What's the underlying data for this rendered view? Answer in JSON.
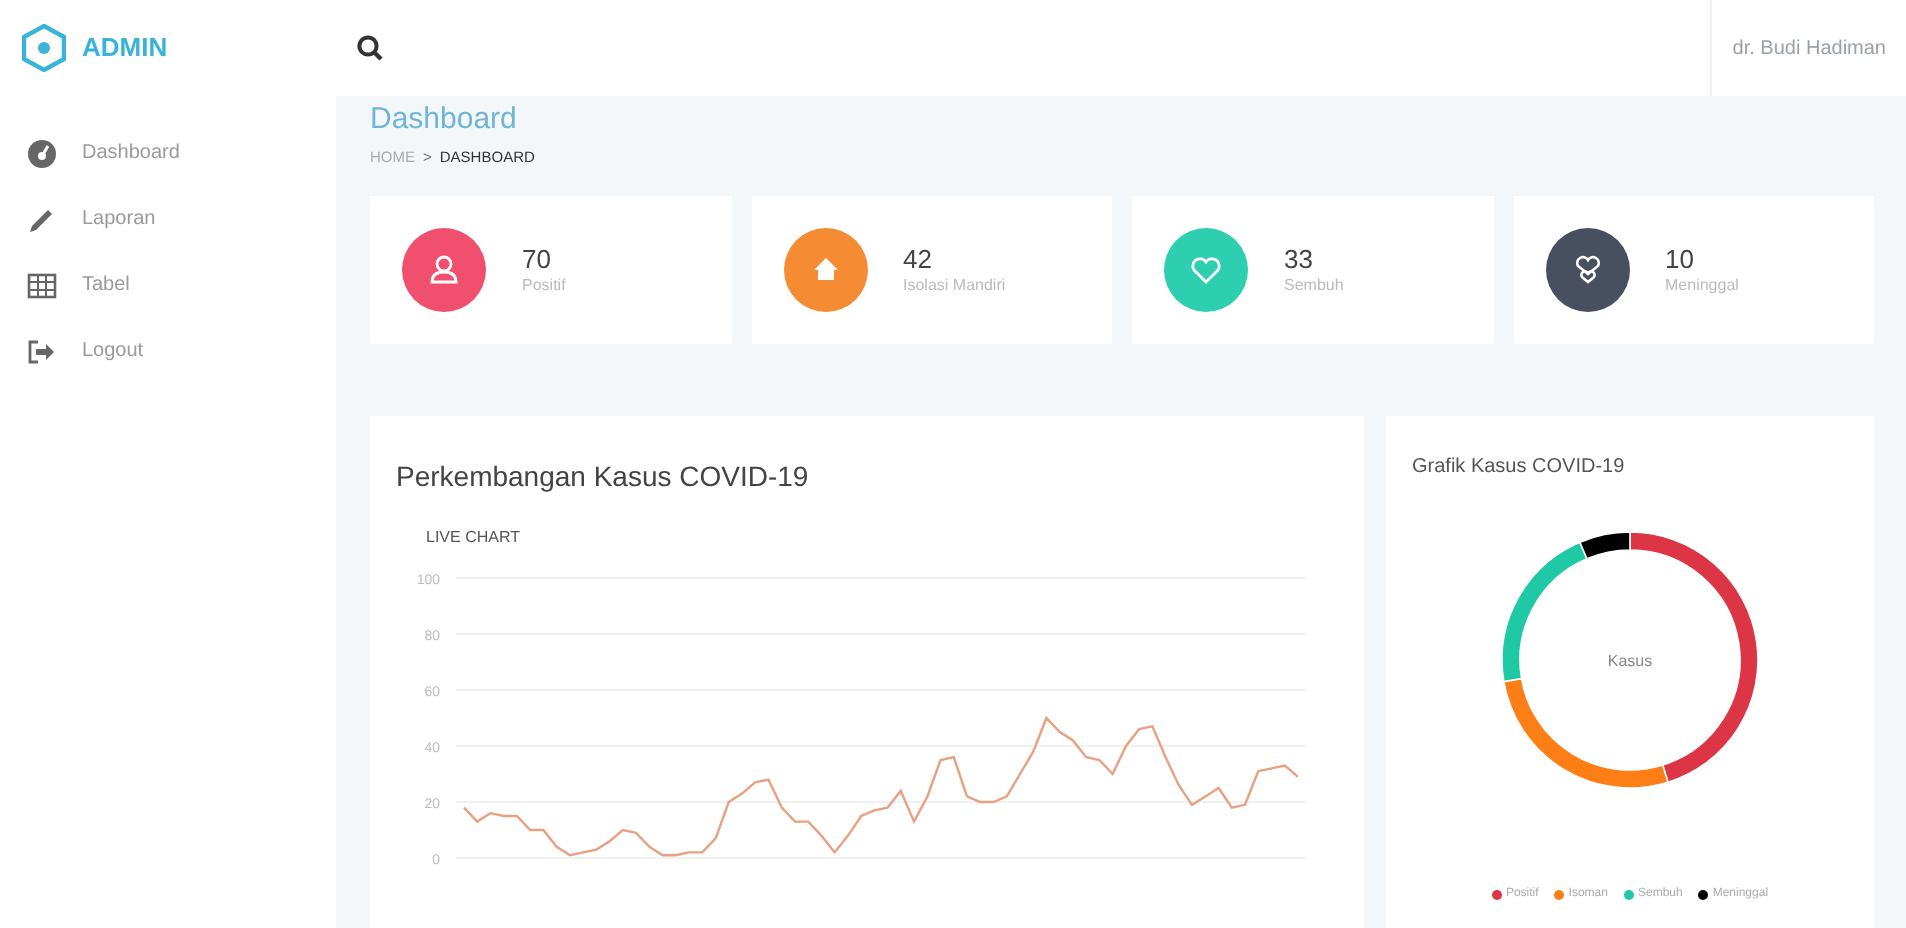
{
  "brand": {
    "name": "ADMIN"
  },
  "sidebar": {
    "items": [
      {
        "label": "Dashboard",
        "kind": "dashboard"
      },
      {
        "label": "Laporan",
        "kind": "pencil"
      },
      {
        "label": "Tabel",
        "kind": "table"
      },
      {
        "label": "Logout",
        "kind": "logout"
      }
    ]
  },
  "topbar": {
    "user": "dr. Budi Hadiman"
  },
  "page": {
    "title": "Dashboard",
    "breadcrumb": [
      "HOME",
      "DASHBOARD"
    ],
    "separator": ">"
  },
  "stats": [
    {
      "value": "70",
      "label": "Positif",
      "kind": "person",
      "color": "#f0506e"
    },
    {
      "value": "42",
      "label": "Isolasi Mandiri",
      "kind": "home",
      "color": "#f58b33"
    },
    {
      "value": "33",
      "label": "Sembuh",
      "kind": "heart",
      "color": "#2ecfb0"
    },
    {
      "value": "10",
      "label": "Meninggal",
      "kind": "hearts",
      "color": "#474f60"
    }
  ],
  "line_card": {
    "title": "Perkembangan Kasus COVID-19",
    "chart_data": {
      "type": "line",
      "title": "LIVE CHART",
      "ylim": [
        0,
        100
      ],
      "yticks": [
        0,
        20,
        40,
        60,
        80,
        100
      ],
      "grid": true,
      "series": [
        {
          "color": "#e8a080",
          "values": [
            18,
            13,
            16,
            15,
            15,
            10,
            10,
            4,
            1,
            2,
            3,
            6,
            10,
            9,
            4,
            1,
            1,
            2,
            2,
            7,
            20,
            23,
            27,
            28,
            18,
            13,
            13,
            8,
            2,
            8,
            15,
            17,
            18,
            24,
            13,
            22,
            35,
            36,
            22,
            20,
            20,
            22,
            30,
            38,
            50,
            45,
            42,
            36,
            35,
            30,
            40,
            46,
            47,
            36,
            26,
            19,
            22,
            25,
            18,
            19,
            31,
            32,
            33,
            29
          ]
        }
      ]
    }
  },
  "donut_card": {
    "title": "Grafik Kasus COVID-19",
    "chart_data": {
      "type": "donut",
      "title": "Kasus",
      "categories": [
        "Positif",
        "Isoman",
        "Sembuh",
        "Meninggal"
      ],
      "values": [
        45.2,
        27.1,
        21.3,
        6.4
      ],
      "legend": true,
      "colors": [
        "#dc3545",
        "#fd7e14",
        "#20c9a6",
        "#000000"
      ]
    }
  }
}
